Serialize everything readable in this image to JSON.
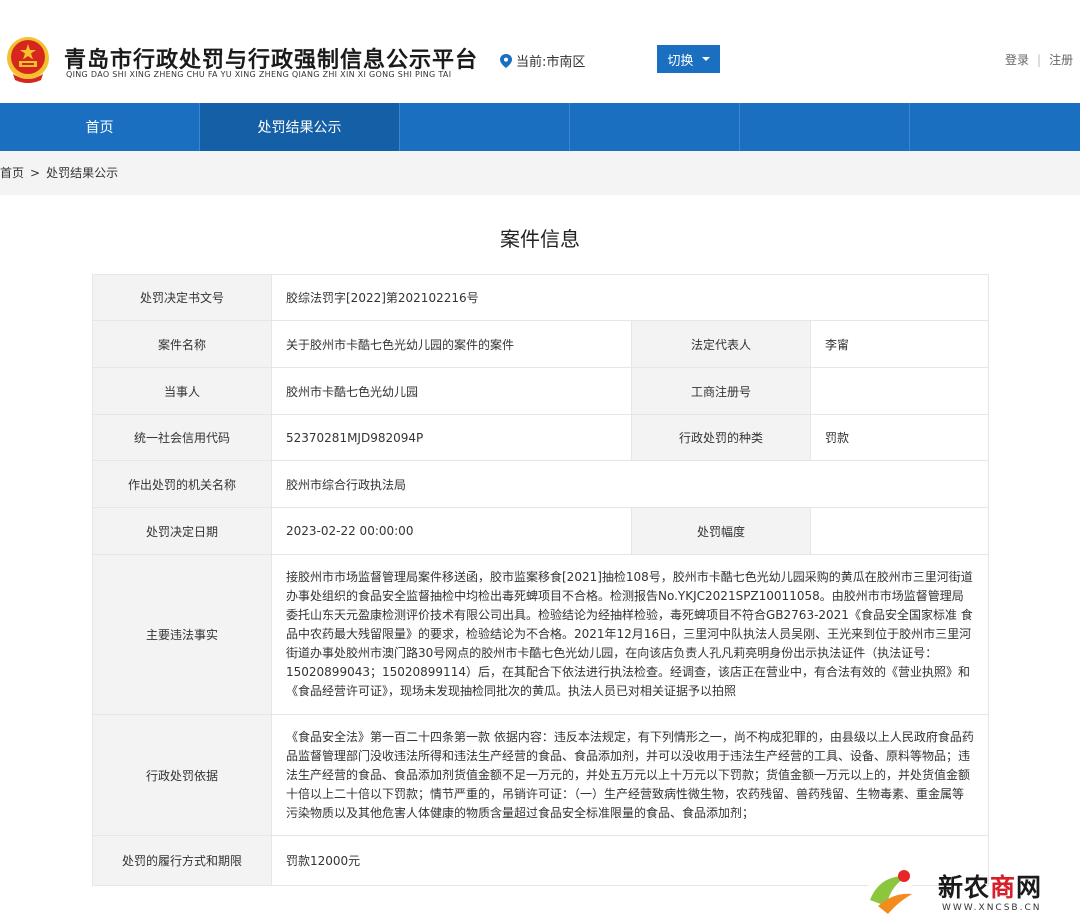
{
  "header": {
    "title": "青岛市行政处罚与行政强制信息公示平台",
    "subtitle": "QING DAO SHI XING ZHENG CHU FA YU XING ZHENG QIANG ZHI XIN XI GONG SHI PING TAI",
    "location": "当前:市南区",
    "switch_label": "切换",
    "login": "登录",
    "separator": "|",
    "register": "注册"
  },
  "nav": {
    "items": [
      "首页",
      "处罚结果公示"
    ]
  },
  "breadcrumb": {
    "home": "首页",
    "arrow": ">",
    "current": "处罚结果公示"
  },
  "panel": {
    "title": "案件信息"
  },
  "case": {
    "doc_no_label": "处罚决定书文号",
    "doc_no": "胶综法罚字[2022]第202102216号",
    "case_name_label": "案件名称",
    "case_name": "关于胶州市卡酷七色光幼儿园的案件的案件",
    "legal_rep_label": "法定代表人",
    "legal_rep": "李甯",
    "party_label": "当事人",
    "party": "胶州市卡酷七色光幼儿园",
    "biz_reg_label": "工商注册号",
    "biz_reg": "",
    "credit_code_label": "统一社会信用代码",
    "credit_code": "52370281MJD982094P",
    "penalty_type_label": "行政处罚的种类",
    "penalty_type": "罚款",
    "authority_label": "作出处罚的机关名称",
    "authority": "胶州市综合行政执法局",
    "date_label": "处罚决定日期",
    "date": "2023-02-22 00:00:00",
    "range_label": "处罚幅度",
    "range": "",
    "facts_label": "主要违法事实",
    "facts": "接胶州市市场监督管理局案件移送函，胶市监案移食[2021]抽检108号，胶州市卡酷七色光幼儿园采购的黄瓜在胶州市三里河街道办事处组织的食品安全监督抽检中均检出毒死蜱项目不合格。检测报告No.YKJC2021SPZ10011058。由胶州市市场监督管理局委托山东天元盈康检测评价技术有限公司出具。检验结论为经抽样检验，毒死蜱项目不符合GB2763-2021《食品安全国家标准 食品中农药最大残留限量》的要求，检验结论为不合格。2021年12月16日，三里河中队执法人员吴刚、王光来到位于胶州市三里河街道办事处胶州市澳门路30号网点的胶州市卡酷七色光幼儿园，在向该店负责人孔凡莉亮明身份出示执法证件（执法证号：15020899043；15020899114）后，在其配合下依法进行执法检查。经调查，该店正在营业中，有合法有效的《营业执照》和《食品经营许可证》，现场未发现抽检同批次的黄瓜。执法人员已对相关证据予以拍照",
    "basis_label": "行政处罚依据",
    "basis": "《食品安全法》第一百二十四条第一款 依据内容：违反本法规定，有下列情形之一，尚不构成犯罪的，由县级以上人民政府食品药品监督管理部门没收违法所得和违法生产经营的食品、食品添加剂，并可以没收用于违法生产经营的工具、设备、原料等物品；违法生产经营的食品、食品添加剂货值金额不足一万元的，并处五万元以上十万元以下罚款；货值金额一万元以上的，并处货值金额十倍以上二十倍以下罚款；情节严重的，吊销许可证：（一）生产经营致病性微生物，农药残留、兽药残留、生物毒素、重金属等污染物质以及其他危害人体健康的物质含量超过食品安全标准限量的食品、食品添加剂；",
    "execution_label": "处罚的履行方式和期限",
    "execution": "罚款12000元"
  },
  "watermark": {
    "text_a": "新农",
    "text_b": "商",
    "text_c": "网",
    "url": "WWW.XNCSB.CN"
  },
  "colors": {
    "nav_blue": "#1a6fc0",
    "label_bg": "#f3f3f3",
    "emblem_red": "#d6261d",
    "emblem_gold": "#f2c12e"
  }
}
